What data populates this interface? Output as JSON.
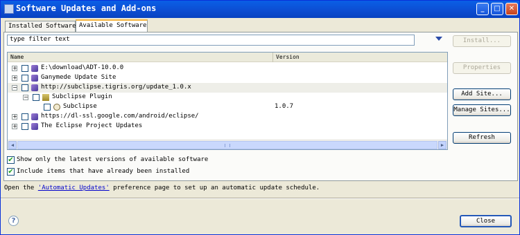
{
  "window": {
    "title": "Software Updates and Add-ons",
    "minimize_glyph": "_",
    "maximize_glyph": "□",
    "close_glyph": "✕"
  },
  "tabs": [
    {
      "label": "Installed Software",
      "active": false
    },
    {
      "label": "Available Software",
      "active": true
    }
  ],
  "filter": {
    "value": "type filter text"
  },
  "tree": {
    "columns": [
      "Name",
      "Version"
    ],
    "rows": [
      {
        "level": 0,
        "expander": "+",
        "type": "site",
        "label": "E:\\download\\ADT-10.0.0",
        "version": "",
        "selected": false
      },
      {
        "level": 0,
        "expander": "+",
        "type": "site",
        "label": "Ganymede Update Site",
        "version": "",
        "selected": false
      },
      {
        "level": 0,
        "expander": "−",
        "type": "site",
        "label": "http://subclipse.tigris.org/update_1.0.x",
        "version": "",
        "selected": true
      },
      {
        "level": 1,
        "expander": "−",
        "type": "feature",
        "label": "Subclipse Plugin",
        "version": "",
        "selected": false
      },
      {
        "level": 2,
        "expander": "",
        "type": "plugin",
        "label": "Subclipse",
        "version": "1.0.7",
        "selected": false
      },
      {
        "level": 0,
        "expander": "+",
        "type": "site",
        "label": "https://dl-ssl.google.com/android/eclipse/",
        "version": "",
        "selected": false
      },
      {
        "level": 0,
        "expander": "+",
        "type": "site",
        "label": "The Eclipse Project Updates",
        "version": "",
        "selected": false
      }
    ]
  },
  "options": [
    {
      "label": "Show only the latest versions of available software",
      "checked": true
    },
    {
      "label": "Include items that have already been installed",
      "checked": true
    }
  ],
  "buttons": {
    "install": "Install...",
    "properties": "Properties",
    "add_site": "Add Site...",
    "manage_sites": "Manage Sites...",
    "refresh": "Refresh",
    "close": "Close"
  },
  "footer": {
    "prefix": "Open the ",
    "link": "'Automatic Updates'",
    "suffix": " preference page to set up an automatic update schedule."
  },
  "help_glyph": "?",
  "check_glyph": "✔",
  "colors": {
    "title_bar": "#0c4ed3",
    "link": "#0000cc",
    "check": "#21a121"
  }
}
